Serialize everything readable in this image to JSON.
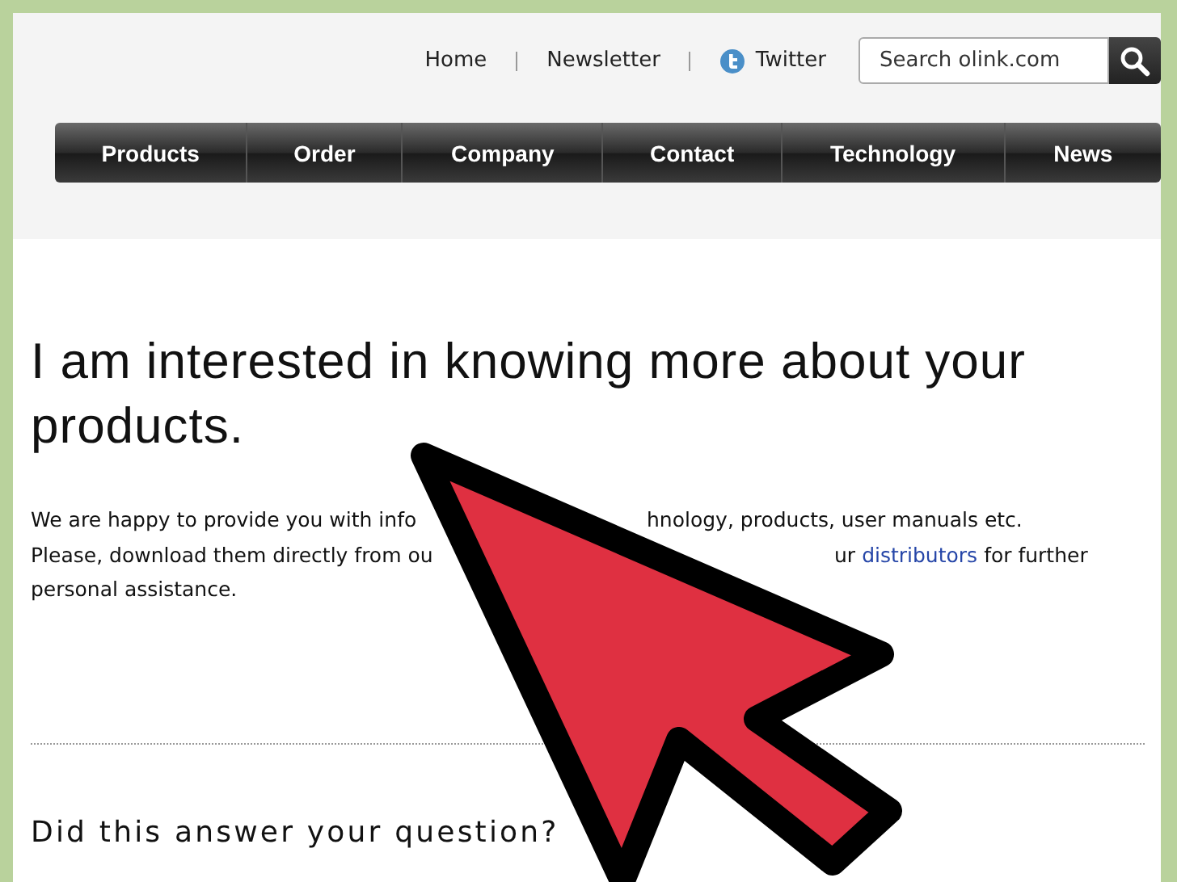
{
  "top_links": [
    {
      "label": "Home",
      "kind": "plain"
    },
    {
      "label": "Newsletter",
      "kind": "plain"
    },
    {
      "label": "Twitter",
      "kind": "social"
    }
  ],
  "search": {
    "placeholder": "Search olink.com"
  },
  "nav": [
    {
      "label": "Products"
    },
    {
      "label": "Order"
    },
    {
      "label": "Company"
    },
    {
      "label": "Contact"
    },
    {
      "label": "Technology"
    },
    {
      "label": "News"
    }
  ],
  "heading": "I am interested in knowing more about your products.",
  "paragraph_lines": [
    [
      [
        {
          "text": "We are happy to provide you with info",
          "link": false
        }
      ],
      [
        {
          "text": "hnology, products, user manuals etc.",
          "link": false
        }
      ]
    ],
    [
      [
        {
          "text": "Please, download them directly from ou",
          "link": false
        }
      ],
      [
        {
          "text": "ur",
          "link": false
        },
        {
          "text": "distributors",
          "link": true
        },
        {
          "text": "for further",
          "link": false
        }
      ]
    ],
    [
      [
        {
          "text": "personal assistance.",
          "link": false
        }
      ]
    ]
  ],
  "question": "Did this answer your question?"
}
